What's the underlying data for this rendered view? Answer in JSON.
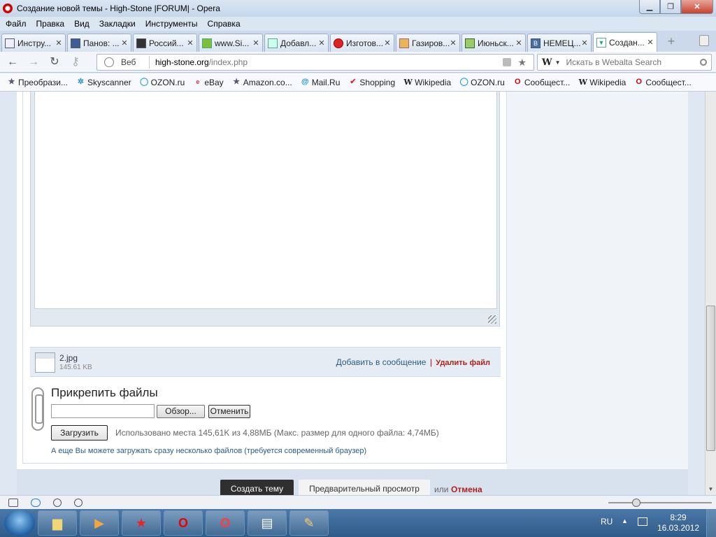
{
  "window": {
    "title": "Создание новой темы - High-Stone |FORUM| - Opera"
  },
  "menu": [
    "Файл",
    "Правка",
    "Вид",
    "Закладки",
    "Инструменты",
    "Справка"
  ],
  "tabs": [
    {
      "label": "Инстру...",
      "icon": "doc-icon"
    },
    {
      "label": "Панов: ...",
      "icon": "vk-like-icon"
    },
    {
      "label": "Россий...",
      "icon": "doc-icon"
    },
    {
      "label": "www.Si...",
      "icon": "leaf-icon"
    },
    {
      "label": "Добавл...",
      "icon": "snowflake-icon"
    },
    {
      "label": "Изготов...",
      "icon": "bug-icon"
    },
    {
      "label": "Газиров...",
      "icon": "hands-icon"
    },
    {
      "label": "Июньск...",
      "icon": "frame-icon"
    },
    {
      "label": "НЕМЕЦ...",
      "icon": "vk-icon"
    },
    {
      "label": "Создан...",
      "icon": "forum-icon"
    }
  ],
  "address": {
    "label": "Веб",
    "domain": "high-stone.org",
    "path": "/index.php"
  },
  "search": {
    "engine_logo": "W",
    "placeholder": "Искать в Webalta Search"
  },
  "bookmarks": [
    {
      "label": "Преобрази...",
      "icon": "star-icon"
    },
    {
      "label": "Skyscanner",
      "icon": "skyscanner-icon"
    },
    {
      "label": "OZON.ru",
      "icon": "ozon-icon"
    },
    {
      "label": "eBay",
      "icon": "ebay-icon"
    },
    {
      "label": "Amazon.co...",
      "icon": "star-icon"
    },
    {
      "label": "Mail.Ru",
      "icon": "at-icon"
    },
    {
      "label": "Shopping",
      "icon": "cart-icon"
    },
    {
      "label": "Wikipedia",
      "icon": "wikipedia-icon"
    },
    {
      "label": "OZON.ru",
      "icon": "ozon-icon"
    },
    {
      "label": "Сообщест...",
      "icon": "opera-icon"
    },
    {
      "label": "Wikipedia",
      "icon": "wikipedia-icon"
    },
    {
      "label": "Сообщест...",
      "icon": "opera-icon"
    }
  ],
  "attachment": {
    "filename": "2.jpg",
    "size": "145.61 KB",
    "add_link": "Добавить в сообщение",
    "separator": "|",
    "delete_link": "Удалить файл"
  },
  "attach_section": {
    "title": "Прикрепить файлы",
    "browse": "Обзор...",
    "cancel": "Отменить",
    "upload": "Загрузить",
    "usage": "Использовано места 145,61K из 4,88МБ (Макс. размер для одного файла: 4,74МБ)",
    "multi_hint": "А еще Вы можете загружать сразу несколько файлов (требуется современный браузер)"
  },
  "form_actions": {
    "submit": "Создать тему",
    "preview": "Предварительный просмотр",
    "or": "или",
    "cancel": "Отмена"
  },
  "taskbar": {
    "lang": "RU",
    "time": "8:29",
    "date": "16.03.2012"
  }
}
